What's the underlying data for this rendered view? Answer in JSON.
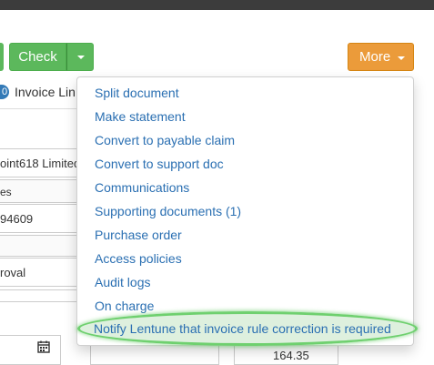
{
  "toolbar": {
    "check_label": "Check",
    "more_label": "More"
  },
  "tabs": {
    "invoice_lines_badge": "0",
    "invoice_lines_label": "Invoice Lin"
  },
  "background": {
    "company": "oint618 Limited",
    "col_label_1": "es",
    "number": "94609",
    "status": "roval",
    "amount": "164.35"
  },
  "menu": {
    "items": [
      {
        "label": "Split document"
      },
      {
        "label": "Make statement"
      },
      {
        "label": "Convert to payable claim"
      },
      {
        "label": "Convert to support doc"
      },
      {
        "label": "Communications"
      },
      {
        "label": "Supporting documents (1)"
      },
      {
        "label": "Purchase order"
      },
      {
        "label": "Access policies"
      },
      {
        "label": "Audit logs"
      },
      {
        "label": "On charge"
      },
      {
        "label": "Notify Lentune that invoice rule correction is required"
      }
    ]
  },
  "colors": {
    "check_button": "#5cb85c",
    "more_button": "#eb9b3a",
    "link": "#2a6fb2",
    "highlight": "#6fd06f"
  },
  "icons": {
    "calendar": "calendar-icon",
    "caret": "chevron-down-icon"
  }
}
